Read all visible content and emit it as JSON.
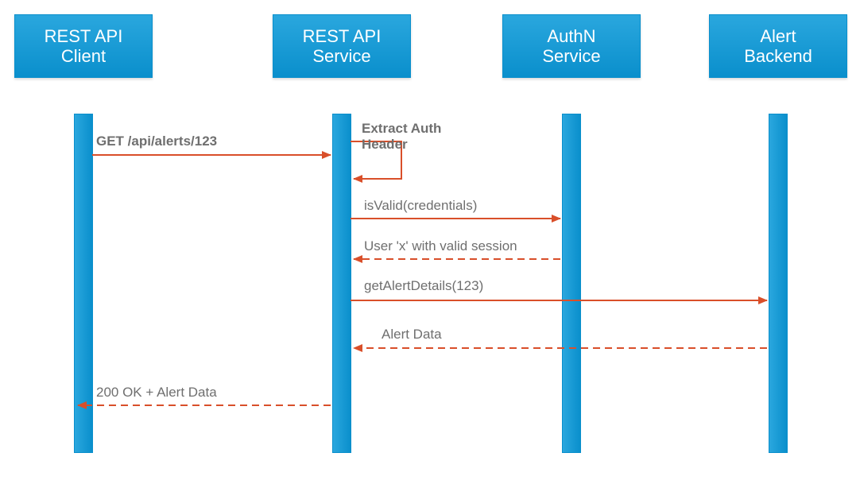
{
  "actors": {
    "client": "REST API\nClient",
    "service": "REST API\nService",
    "authn": "AuthN\nService",
    "backend": "Alert\nBackend"
  },
  "messages": {
    "get_request": "GET /api/alerts/123",
    "extract_header": "Extract Auth\nHeader",
    "is_valid": "isValid(credentials)",
    "valid_session": "User 'x' with valid session",
    "get_alert_details": "getAlertDetails(123)",
    "alert_data": "Alert Data",
    "response_200": "200 OK + Alert Data"
  },
  "colors": {
    "actor_fill": "#0a9bd6",
    "arrow": "#d94f2a",
    "text": "#6f6f6f"
  },
  "chart_data": {
    "type": "sequence-diagram",
    "participants": [
      "REST API Client",
      "REST API Service",
      "AuthN Service",
      "Alert Backend"
    ],
    "interactions": [
      {
        "from": "REST API Client",
        "to": "REST API Service",
        "label": "GET /api/alerts/123",
        "style": "solid",
        "dir": "request"
      },
      {
        "from": "REST API Service",
        "to": "REST API Service",
        "label": "Extract Auth Header",
        "style": "solid",
        "dir": "self"
      },
      {
        "from": "REST API Service",
        "to": "AuthN Service",
        "label": "isValid(credentials)",
        "style": "solid",
        "dir": "request"
      },
      {
        "from": "AuthN Service",
        "to": "REST API Service",
        "label": "User 'x' with valid session",
        "style": "dashed",
        "dir": "response"
      },
      {
        "from": "REST API Service",
        "to": "Alert Backend",
        "label": "getAlertDetails(123)",
        "style": "solid",
        "dir": "request"
      },
      {
        "from": "Alert Backend",
        "to": "REST API Service",
        "label": "Alert Data",
        "style": "dashed",
        "dir": "response"
      },
      {
        "from": "REST API Service",
        "to": "REST API Client",
        "label": "200 OK + Alert Data",
        "style": "dashed",
        "dir": "response"
      }
    ]
  }
}
